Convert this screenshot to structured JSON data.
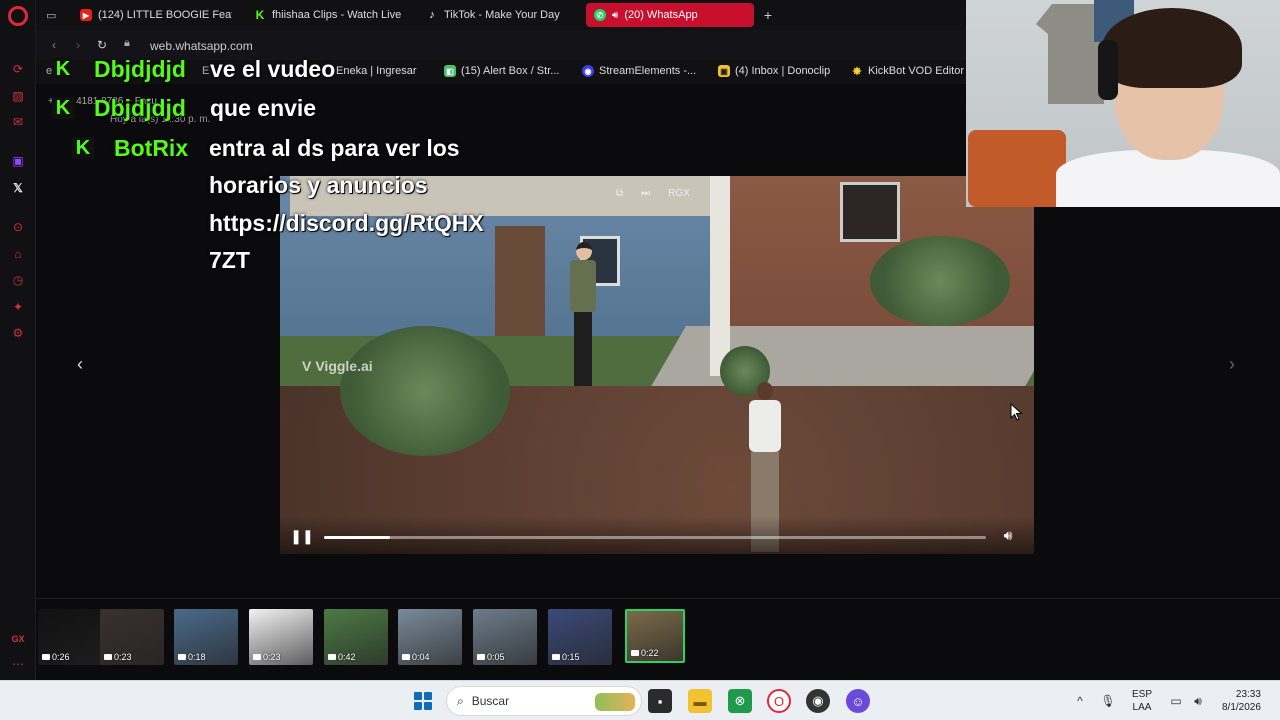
{
  "browser": {
    "tabs": [
      {
        "label": "(124) LITTLE BOOGIE Feat",
        "icon": "youtube-icon",
        "active": false
      },
      {
        "label": "fhiishaa Clips - Watch Live",
        "icon": "kick-icon",
        "active": false
      },
      {
        "label": "TikTok - Make Your Day",
        "icon": "tiktok-icon",
        "active": false
      },
      {
        "label": "(20) WhatsApp",
        "icon": "whatsapp-icon",
        "active": true
      }
    ],
    "url": "web.whatsapp.com",
    "bookmarks": [
      {
        "label": "Eneka | Ingresar"
      },
      {
        "label": "(15) Alert Box / Str..."
      },
      {
        "label": "StreamElements -..."
      },
      {
        "label": "(4) Inbox | Donoclip"
      },
      {
        "label": "KickBot VOD Editor"
      }
    ],
    "bookmark_partial": "e b",
    "bookmark_partial2": "E"
  },
  "whatsapp_viewer": {
    "sender_header": "+56 9 4181 8786 ~ Facu",
    "timestamp": "Hoy a la(s) 11:30 p. m.",
    "video_watermark": "Viggle.ai",
    "video_top_label": "RGX",
    "progress_fraction": 0.1,
    "thumbnails": [
      {
        "duration": "0:26",
        "tone": "#111111"
      },
      {
        "duration": "0:23",
        "tone": "#3a3030"
      },
      {
        "duration": "0:18",
        "tone": "#4a6a8a"
      },
      {
        "duration": "0:23",
        "tone": "#f2f2f2"
      },
      {
        "duration": "0:42",
        "tone": "#4c7a44"
      },
      {
        "duration": "0:04",
        "tone": "#7a8a9a"
      },
      {
        "duration": "0:05",
        "tone": "#6d7c8a"
      },
      {
        "duration": "0:15",
        "tone": "#3a4a7a"
      },
      {
        "duration": "0:22",
        "tone": "#7a6a4a",
        "active": true
      }
    ]
  },
  "stream_overlay": {
    "messages": [
      {
        "user": "Dbjdjdjd",
        "text": "ve el vudeo"
      },
      {
        "user": "Dbjdjdjd",
        "text": "que envie"
      },
      {
        "user": "BotRix",
        "lines": [
          "entra al ds para ver los",
          "horarios y anuncios",
          "https://discord.gg/RtQHX",
          "7ZT"
        ]
      }
    ],
    "user_color": "#53fc18"
  },
  "taskbar": {
    "search_placeholder": "Buscar",
    "language_top": "ESP",
    "language_bottom": "LAA",
    "time": "23:33",
    "date": "8/1/2026"
  },
  "colors": {
    "opera_red": "#e2283a",
    "active_tab": "#c8102e",
    "whatsapp_green": "#25d366",
    "kick_green": "#53fc18"
  }
}
